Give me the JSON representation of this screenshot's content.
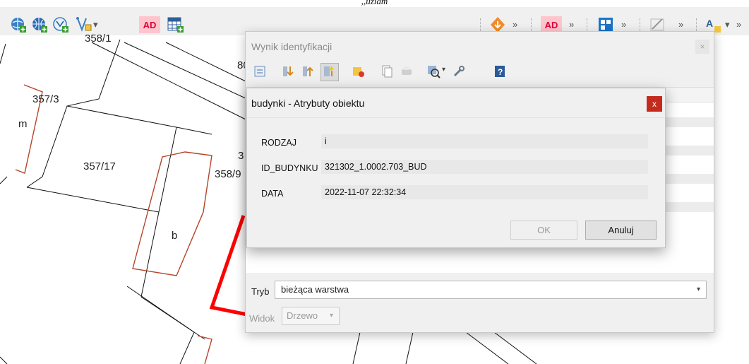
{
  "caption": ",,uziam",
  "toolbar": {
    "left_icons": [
      "globe-add-icon",
      "globe-add-icon",
      "vector-globe-add-icon",
      "vertex-tool-icon",
      "ad-icon",
      "grid-table-add-icon"
    ],
    "ad_label": "AD",
    "right_icons": [
      "orange-fire-icon",
      "ad-icon",
      "blue-grid-icon",
      "draw-tool-icon",
      "label-tool-icon"
    ],
    "chevron": "»",
    "dropdown_arrow": "▾"
  },
  "map": {
    "labels": [
      "358/1",
      "357/3",
      "m",
      "357/17",
      "358/9",
      "b",
      "80",
      "3"
    ]
  },
  "identify_window": {
    "title": "Wynik identyfikacji",
    "close_glyph": "×",
    "tools": [
      "expand-tree-icon",
      "expand-all-icon",
      "collapse-all-icon",
      "highlight-icon",
      "clear-results-icon",
      "copy-icon",
      "print-icon",
      "identify-menu-icon",
      "settings-wrench-icon",
      "help-icon"
    ],
    "tryb_label": "Tryb",
    "tryb_value": "bieżąca warstwa",
    "widok_label": "Widok",
    "widok_value": "Drzewo"
  },
  "dialog": {
    "title": "budynki - Atrybuty obiektu",
    "close_glyph": "x",
    "fields": [
      {
        "label": "RODZAJ",
        "value": "i"
      },
      {
        "label": "ID_BUDYNKU",
        "value": "321302_1.0002.703_BUD"
      },
      {
        "label": "DATA",
        "value": "2022-11-07 22:32:34"
      }
    ],
    "ok_label": "OK",
    "cancel_label": "Anuluj"
  },
  "colors": {
    "accent_red": "#c42b1c",
    "parcel_red": "#b5442a",
    "highlight_red": "#ff0000",
    "ad_pink": "#ffc5cc"
  }
}
